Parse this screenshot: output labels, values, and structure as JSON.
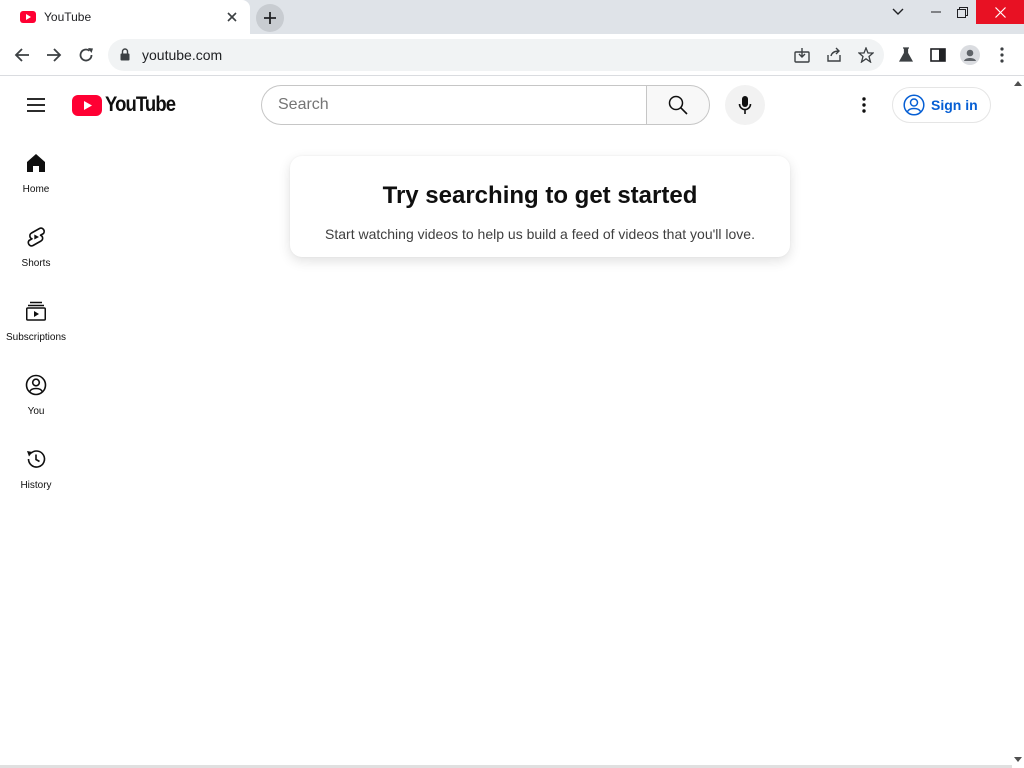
{
  "browser": {
    "tab_title": "YouTube",
    "url": "youtube.com"
  },
  "masthead": {
    "logo_text": "YouTube",
    "search_placeholder": "Search",
    "signin_label": "Sign in"
  },
  "guide": {
    "items": [
      {
        "label": "Home",
        "icon": "home-icon"
      },
      {
        "label": "Shorts",
        "icon": "shorts-icon"
      },
      {
        "label": "Subscriptions",
        "icon": "subscriptions-icon"
      },
      {
        "label": "You",
        "icon": "you-icon"
      },
      {
        "label": "History",
        "icon": "history-icon"
      }
    ]
  },
  "feed_prompt": {
    "title": "Try searching to get started",
    "subtitle": "Start watching videos to help us build a feed of videos that you'll love."
  },
  "colors": {
    "brand_red": "#ff0033",
    "link_blue": "#065fd4",
    "window_close_red": "#e81123"
  }
}
